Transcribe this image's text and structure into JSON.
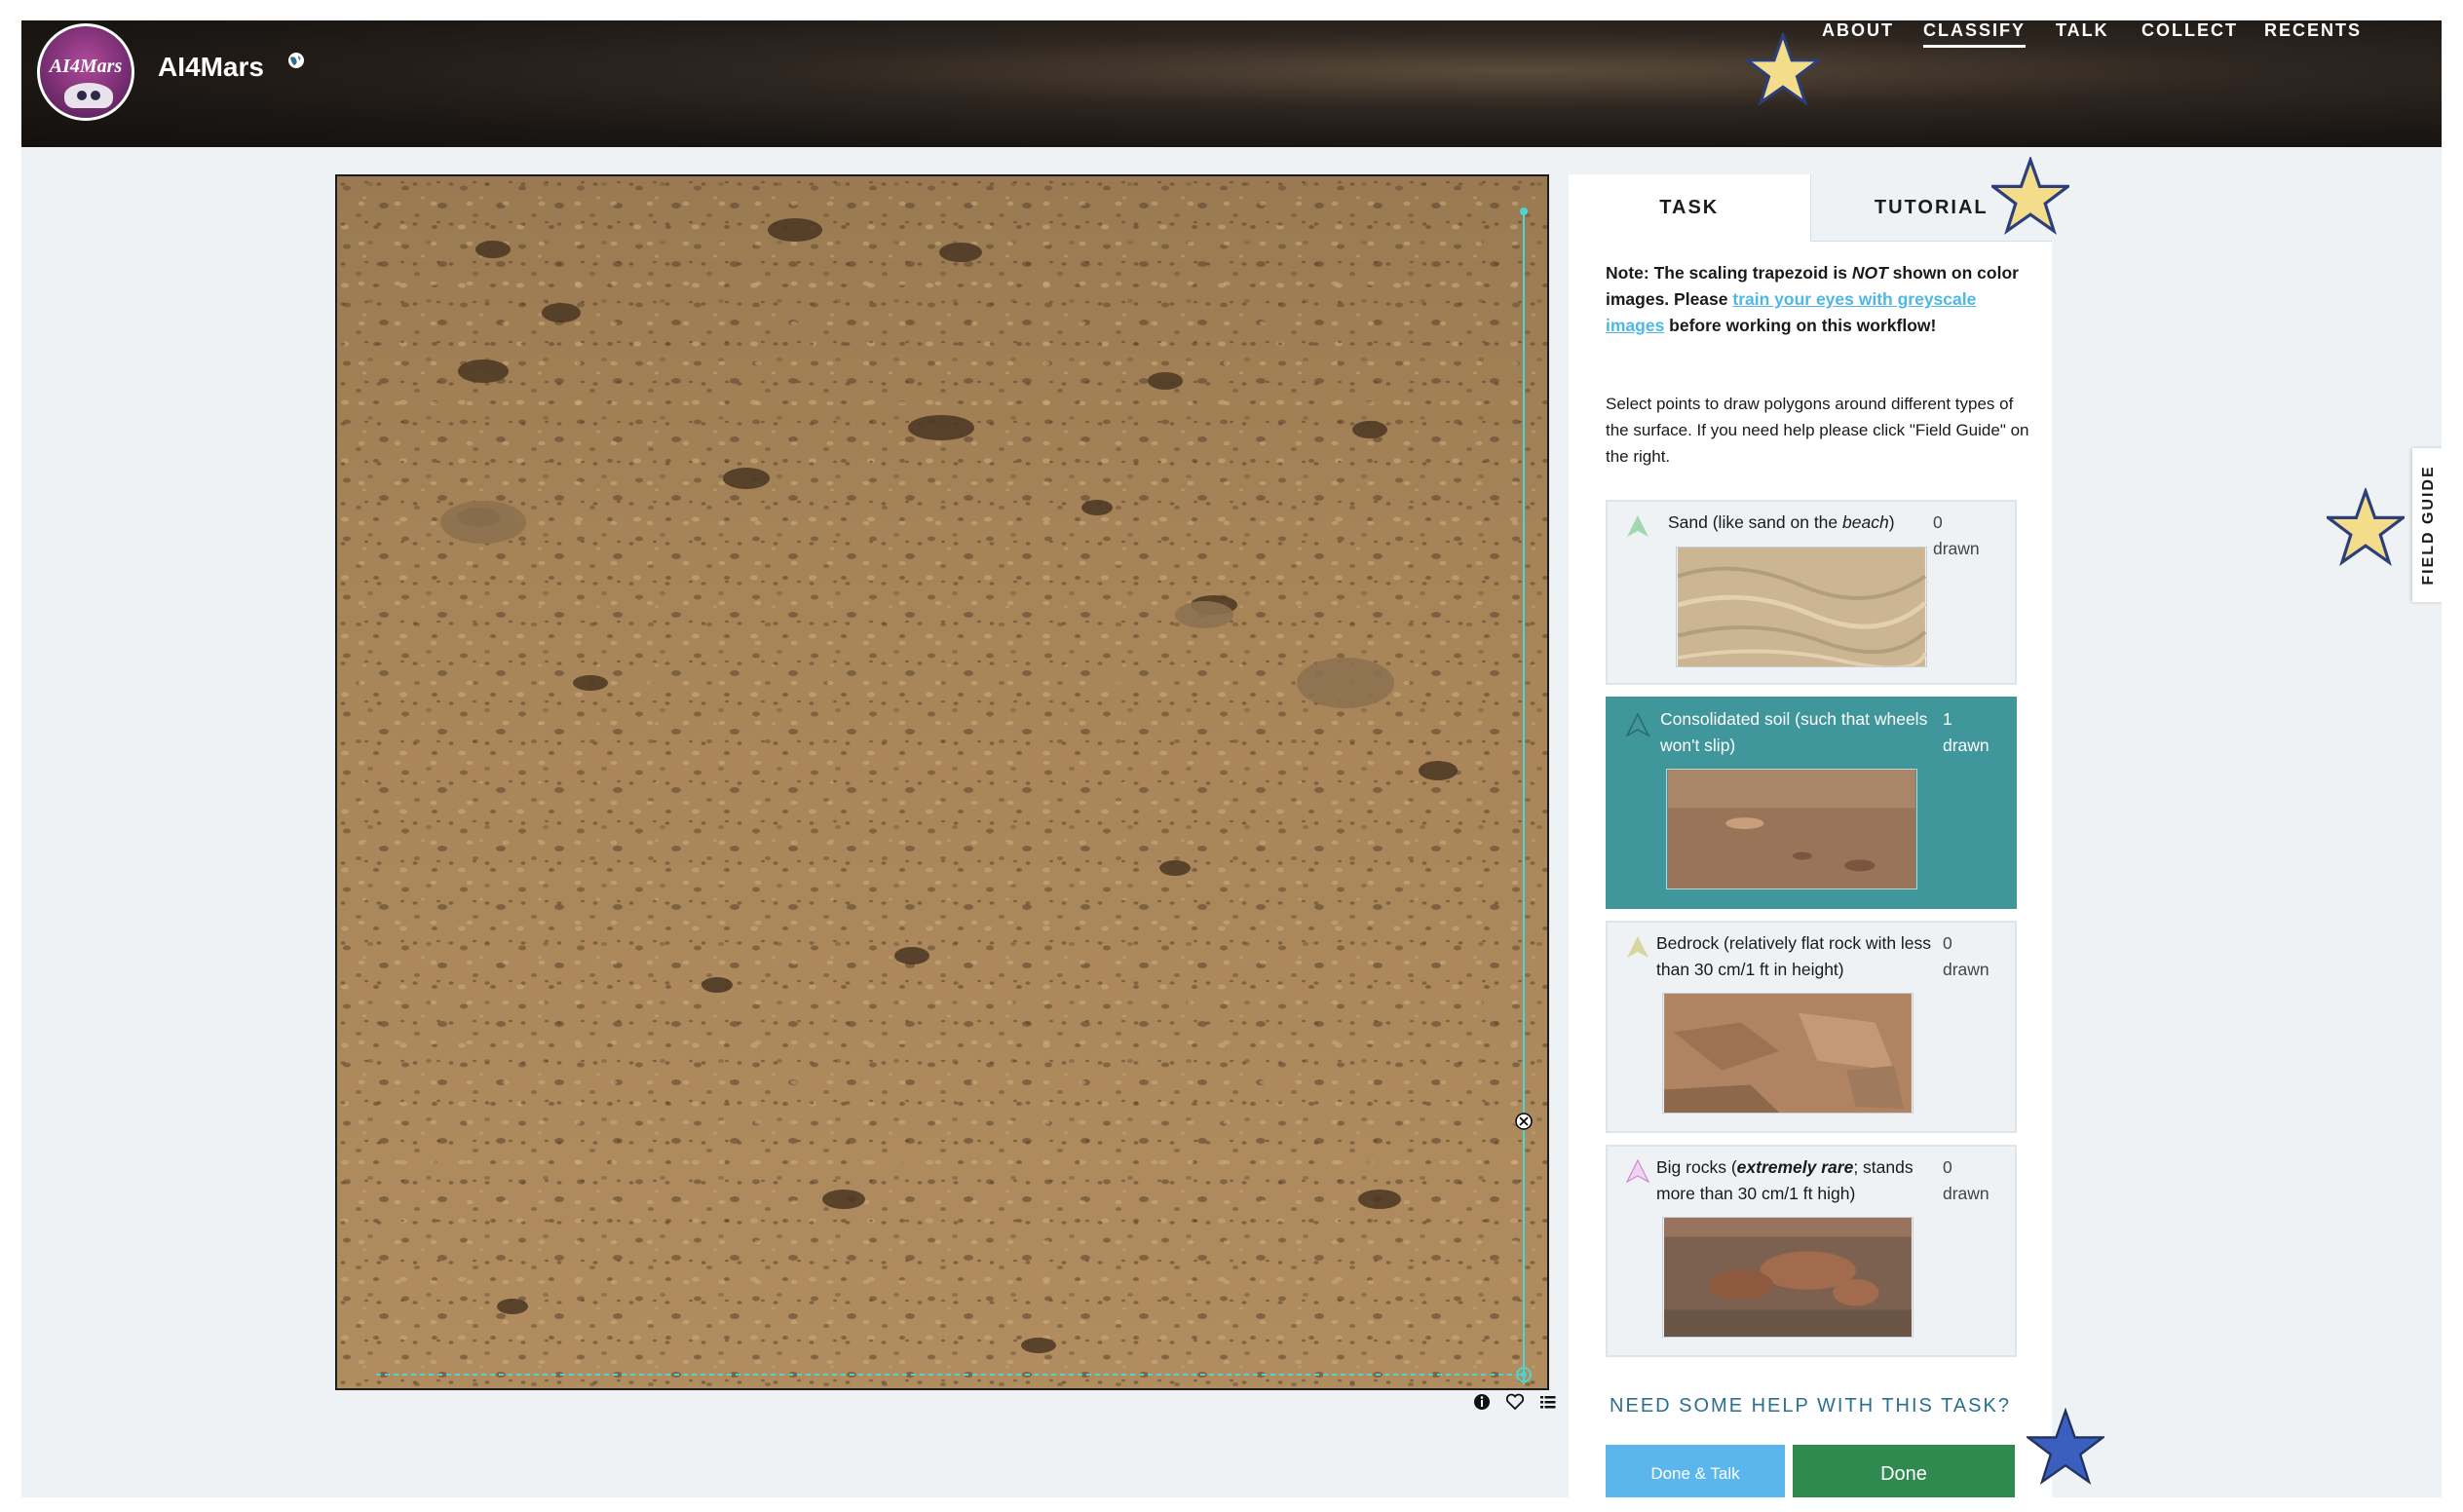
{
  "header": {
    "site_title": "AI4Mars",
    "logo_text": "AI4Mars",
    "nav": [
      {
        "label": "ABOUT",
        "active": false
      },
      {
        "label": "CLASSIFY",
        "active": true
      },
      {
        "label": "TALK",
        "active": false
      },
      {
        "label": "COLLECT",
        "active": false
      },
      {
        "label": "RECENTS",
        "active": false
      }
    ]
  },
  "colors": {
    "header_bg": "#1b1714",
    "page_bg": "#eff2f5",
    "accent_teal": "#3f979b",
    "link_blue": "#4eb7e6",
    "done_green": "#2f8a4f",
    "talk_blue": "#5bb6ed",
    "drawing_line": "#4fd4d6",
    "star_fill": "#f3dc8a",
    "star_dark": "#3a5fbf"
  },
  "tabs": [
    {
      "label": "TASK",
      "active": true
    },
    {
      "label": "TUTORIAL",
      "active": false
    }
  ],
  "task": {
    "note_prefix": "Note: The scaling trapezoid is ",
    "note_emph": "NOT",
    "note_mid": " shown on color images. Please ",
    "note_link": "train your eyes with greyscale images",
    "note_suffix": " before working on this workflow!",
    "instructions": "Select points to draw polygons around different types of the surface. If you need help please click \"Field Guide\" on the right.",
    "answers": [
      {
        "label_pre": "Sand (like sand on the ",
        "label_emph": "beach",
        "label_post": ")",
        "count": "0",
        "count_unit": "drawn",
        "shape_color": "#8fd19e",
        "selected": false,
        "thumb": "sand"
      },
      {
        "label_pre": "Consolidated soil (such that wheels won't slip)",
        "label_emph": "",
        "label_post": "",
        "count": "1",
        "count_unit": "drawn",
        "shape_color": "#3f979b",
        "selected": true,
        "thumb": "soil"
      },
      {
        "label_pre": "Bedrock (relatively flat rock with less than 30 cm/1 ft in height)",
        "label_emph": "",
        "label_post": "",
        "count": "0",
        "count_unit": "drawn",
        "shape_color": "#d8d6a0",
        "selected": false,
        "thumb": "bedrock"
      },
      {
        "label_pre": "Big rocks (",
        "label_emph": "extremely rare",
        "label_post": "; stands more than 30 cm/1 ft high)",
        "count": "0",
        "count_unit": "drawn",
        "shape_color": "#e6a6e6",
        "selected": false,
        "thumb": "rocks"
      }
    ],
    "help_link": "NEED SOME HELP WITH THIS TASK?",
    "done_talk": "Done & Talk",
    "done": "Done"
  },
  "field_guide": "FIELD GUIDE",
  "icons": {
    "metadata": "info-icon",
    "favorite": "heart-icon",
    "collect": "list-icon",
    "language": "globe-icon",
    "delete_point": "close-circle-icon"
  }
}
